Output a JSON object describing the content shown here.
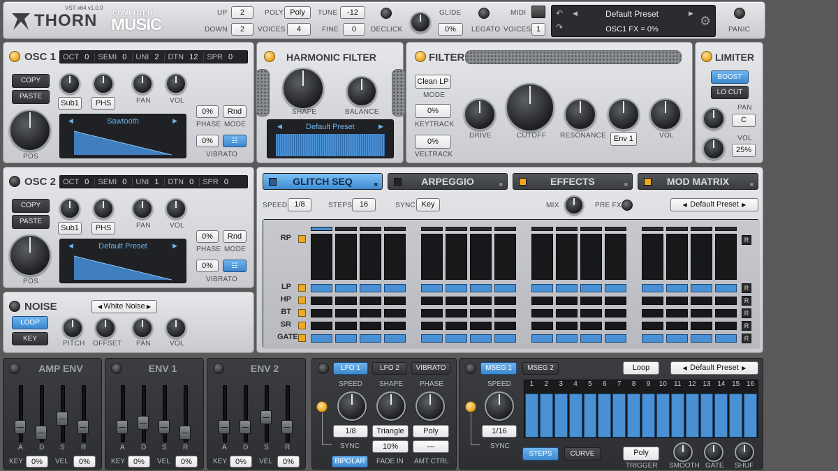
{
  "header": {
    "brand": "THORN",
    "version": "VST x64 v1.0.0",
    "magazine_top": "COMPUTER",
    "magazine_bottom": "MUSIC",
    "up_label": "UP",
    "up_value": "2",
    "down_label": "DOWN",
    "down_value": "2",
    "poly_label": "POLY",
    "poly_value": "Poly",
    "voices_label": "VOICES",
    "voices_value": "4",
    "tune_label": "TUNE",
    "tune_value": "-12",
    "fine_label": "FINE",
    "fine_value": "0",
    "declick_label": "DECLICK",
    "glide_label": "GLIDE",
    "glide_value": "0%",
    "legato_label": "LEGATO",
    "midi_label": "MIDI",
    "midi_voices_label": "VOICES",
    "midi_voices_value": "1",
    "preset_name": "Default Preset",
    "preset_status": "OSC1 FX = 0%",
    "panic_label": "PANIC"
  },
  "osc1": {
    "title": "OSC 1",
    "oct_label": "OCT",
    "oct": "0",
    "semi_label": "SEMI",
    "semi": "0",
    "uni_label": "UNI",
    "uni": "2",
    "dtn_label": "DTN",
    "dtn": "12",
    "spr_label": "SPR",
    "spr": "0",
    "copy": "COPY",
    "paste": "PASTE",
    "sub": "Sub1",
    "phs": "PHS",
    "pan": "PAN",
    "vol": "VOL",
    "pos": "POS",
    "wave": "Sawtooth",
    "phase_value": "0%",
    "phase_label": "PHASE",
    "mode_value": "Rnd",
    "mode_label": "MODE",
    "vibrato_value": "0%",
    "vibrato_label": "VIBRATO"
  },
  "osc2": {
    "title": "OSC 2",
    "oct_label": "OCT",
    "oct": "0",
    "semi_label": "SEMI",
    "semi": "0",
    "uni_label": "UNI",
    "uni": "1",
    "dtn_label": "DTN",
    "dtn": "0",
    "spr_label": "SPR",
    "spr": "0",
    "copy": "COPY",
    "paste": "PASTE",
    "sub": "Sub1",
    "phs": "PHS",
    "pan": "PAN",
    "vol": "VOL",
    "pos": "POS",
    "wave": "Default Preset",
    "phase_value": "0%",
    "phase_label": "PHASE",
    "mode_value": "Rnd",
    "mode_label": "MODE",
    "vibrato_value": "0%",
    "vibrato_label": "VIBRATO"
  },
  "noise": {
    "title": "NOISE",
    "type": "White Noise",
    "loop": "LOOP",
    "key": "KEY",
    "pitch": "PITCH",
    "offset": "OFFSET",
    "pan": "PAN",
    "vol": "VOL"
  },
  "harmonic": {
    "title": "HARMONIC FILTER",
    "shape": "SHAPE",
    "balance": "BALANCE",
    "preset": "Default Preset"
  },
  "filter": {
    "title": "FILTER",
    "type": "Clean LP",
    "mode_label": "MODE",
    "keytrack_value": "0%",
    "keytrack_label": "KEYTRACK",
    "veltrack_value": "0%",
    "veltrack_label": "VELTRACK",
    "drive": "DRIVE",
    "cutoff": "CUTOFF",
    "resonance": "RESONANCE",
    "env": "Env 1",
    "vol": "VOL"
  },
  "limiter": {
    "title": "LIMITER",
    "boost": "BOOST",
    "locut": "LO CUT",
    "pan_label": "PAN",
    "pan_value": "C",
    "vol_label": "VOL",
    "vol_value": "25%"
  },
  "seq": {
    "tabs": [
      "GLITCH SEQ",
      "ARPEGGIO",
      "EFFECTS",
      "MOD MATRIX"
    ],
    "speed_label": "SPEED",
    "speed_value": "1/8",
    "steps_label": "STEPS",
    "steps_value": "16",
    "sync_label": "SYNC",
    "sync_value": "Key",
    "mix_label": "MIX",
    "prefx_label": "PRE FX",
    "preset": "Default Preset",
    "rows": [
      "RP",
      "LP",
      "HP",
      "BT",
      "SR",
      "GATE"
    ],
    "reset": "R",
    "active_rows": [
      "LP",
      "GATE"
    ]
  },
  "envs": [
    {
      "title": "AMP ENV",
      "adsr": [
        "A",
        "D",
        "S",
        "R"
      ],
      "key_label": "KEY",
      "key": "0%",
      "vel_label": "VEL",
      "vel": "0%"
    },
    {
      "title": "ENV 1",
      "adsr": [
        "A",
        "D",
        "S",
        "R"
      ],
      "key_label": "KEY",
      "key": "0%",
      "vel_label": "VEL",
      "vel": "0%"
    },
    {
      "title": "ENV 2",
      "adsr": [
        "A",
        "D",
        "S",
        "R"
      ],
      "key_label": "KEY",
      "key": "0%",
      "vel_label": "VEL",
      "vel": "0%"
    }
  ],
  "lfo": {
    "tabs": [
      "LFO 1",
      "LFO 2",
      "VIBRATO"
    ],
    "speed_label": "SPEED",
    "shape_label": "SHAPE",
    "phase_label": "PHASE",
    "speed_value": "1/8",
    "shape_value": "Triangle",
    "phase_value": "Poly",
    "sync_label": "SYNC",
    "fade_value": "10%",
    "amt_value": "---",
    "bipolar": "BIPOLAR",
    "fade_label": "FADE IN",
    "amt_label": "AMT CTRL"
  },
  "mseg": {
    "tabs": [
      "MSEG 1",
      "MSEG 2"
    ],
    "loop": "Loop",
    "preset": "Default Preset",
    "speed_label": "SPEED",
    "speed_value": "1/16",
    "sync_label": "SYNC",
    "steps": [
      "1",
      "2",
      "3",
      "4",
      "5",
      "6",
      "7",
      "8",
      "9",
      "10",
      "11",
      "12",
      "13",
      "14",
      "15",
      "16"
    ],
    "levels": [
      0.92,
      0.92,
      0.92,
      0.92,
      0.92,
      0.92,
      0.92,
      0.92,
      0.92,
      0.92,
      0.92,
      0.92,
      0.92,
      0.92,
      0.92,
      0.92
    ],
    "steps_btn": "STEPS",
    "curve_btn": "CURVE",
    "trigger_value": "Poly",
    "trigger_label": "TRIGGER",
    "smooth": "SMOOTH",
    "gate": "GATE",
    "shuf": "SHUF"
  },
  "colors": {
    "accent_blue": "#4a90d4",
    "led_orange": "#f0a820",
    "panel": "#d6d7db",
    "dark": "#2f3134"
  }
}
